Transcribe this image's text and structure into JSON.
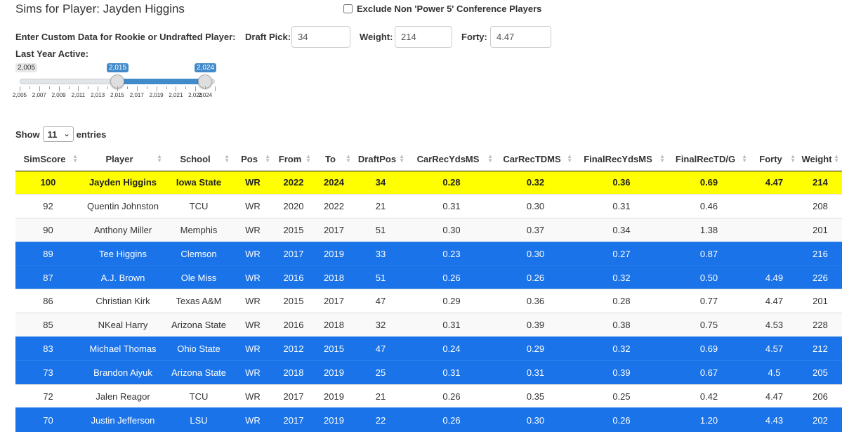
{
  "title": "Sims for Player: Jayden Higgins",
  "exclude_label": "Exclude Non 'Power 5' Conference Players",
  "custom": {
    "label": "Enter Custom Data for Rookie or Undrafted Player:",
    "draft_pick_label": "Draft Pick:",
    "draft_pick_value": "34",
    "weight_label": "Weight:",
    "weight_value": "214",
    "forty_label": "Forty:",
    "forty_value": "4.47"
  },
  "slider": {
    "label": "Last Year Active:",
    "min_label": "2,005",
    "low_label": "2,015",
    "high_label": "2,024",
    "min": 2005,
    "max": 2025,
    "low": 2015,
    "high": 2024,
    "tick_labels": [
      "2,005",
      "2,007",
      "2,009",
      "2,011",
      "2,013",
      "2,015",
      "2,017",
      "2,019",
      "2,021",
      "2,023",
      "2,024"
    ]
  },
  "entries": {
    "show_label": "Show",
    "value": "11",
    "entries_label": "entries"
  },
  "table": {
    "columns": [
      "SimScore",
      "Player",
      "School",
      "Pos",
      "From",
      "To",
      "DraftPos",
      "CarRecYdsMS",
      "CarRecTDMS",
      "FinalRecYdsMS",
      "FinalRecTD/G",
      "Forty",
      "Weight"
    ],
    "rows": [
      {
        "style": "hl",
        "cells": [
          "100",
          "Jayden Higgins",
          "Iowa State",
          "WR",
          "2022",
          "2024",
          "34",
          "0.28",
          "0.32",
          "0.36",
          "0.69",
          "4.47",
          "214"
        ]
      },
      {
        "style": "white",
        "cells": [
          "92",
          "Quentin Johnston",
          "TCU",
          "WR",
          "2020",
          "2022",
          "21",
          "0.31",
          "0.30",
          "0.31",
          "0.46",
          "",
          "208"
        ]
      },
      {
        "style": "gray",
        "cells": [
          "90",
          "Anthony Miller",
          "Memphis",
          "WR",
          "2015",
          "2017",
          "51",
          "0.30",
          "0.37",
          "0.34",
          "1.38",
          "",
          "201"
        ]
      },
      {
        "style": "blue",
        "cells": [
          "89",
          "Tee Higgins",
          "Clemson",
          "WR",
          "2017",
          "2019",
          "33",
          "0.23",
          "0.30",
          "0.27",
          "0.87",
          "",
          "216"
        ]
      },
      {
        "style": "blue",
        "cells": [
          "87",
          "A.J. Brown",
          "Ole Miss",
          "WR",
          "2016",
          "2018",
          "51",
          "0.26",
          "0.26",
          "0.32",
          "0.50",
          "4.49",
          "226"
        ]
      },
      {
        "style": "white",
        "cells": [
          "86",
          "Christian Kirk",
          "Texas A&M",
          "WR",
          "2015",
          "2017",
          "47",
          "0.29",
          "0.36",
          "0.28",
          "0.77",
          "4.47",
          "201"
        ]
      },
      {
        "style": "gray",
        "cells": [
          "85",
          "NKeal Harry",
          "Arizona State",
          "WR",
          "2016",
          "2018",
          "32",
          "0.31",
          "0.39",
          "0.38",
          "0.75",
          "4.53",
          "228"
        ]
      },
      {
        "style": "blue",
        "cells": [
          "83",
          "Michael Thomas",
          "Ohio State",
          "WR",
          "2012",
          "2015",
          "47",
          "0.24",
          "0.29",
          "0.32",
          "0.69",
          "4.57",
          "212"
        ]
      },
      {
        "style": "blue",
        "cells": [
          "73",
          "Brandon Aiyuk",
          "Arizona State",
          "WR",
          "2018",
          "2019",
          "25",
          "0.31",
          "0.31",
          "0.39",
          "0.67",
          "4.5",
          "205"
        ]
      },
      {
        "style": "white",
        "cells": [
          "72",
          "Jalen Reagor",
          "TCU",
          "WR",
          "2017",
          "2019",
          "21",
          "0.26",
          "0.35",
          "0.25",
          "0.42",
          "4.47",
          "206"
        ]
      },
      {
        "style": "blue",
        "cells": [
          "70",
          "Justin Jefferson",
          "LSU",
          "WR",
          "2017",
          "2019",
          "22",
          "0.26",
          "0.30",
          "0.26",
          "1.20",
          "4.43",
          "202"
        ]
      }
    ]
  },
  "colors": {
    "highlight": "#ffff00",
    "blue_row": "#1a73e8",
    "slider_accent": "#428bca"
  }
}
